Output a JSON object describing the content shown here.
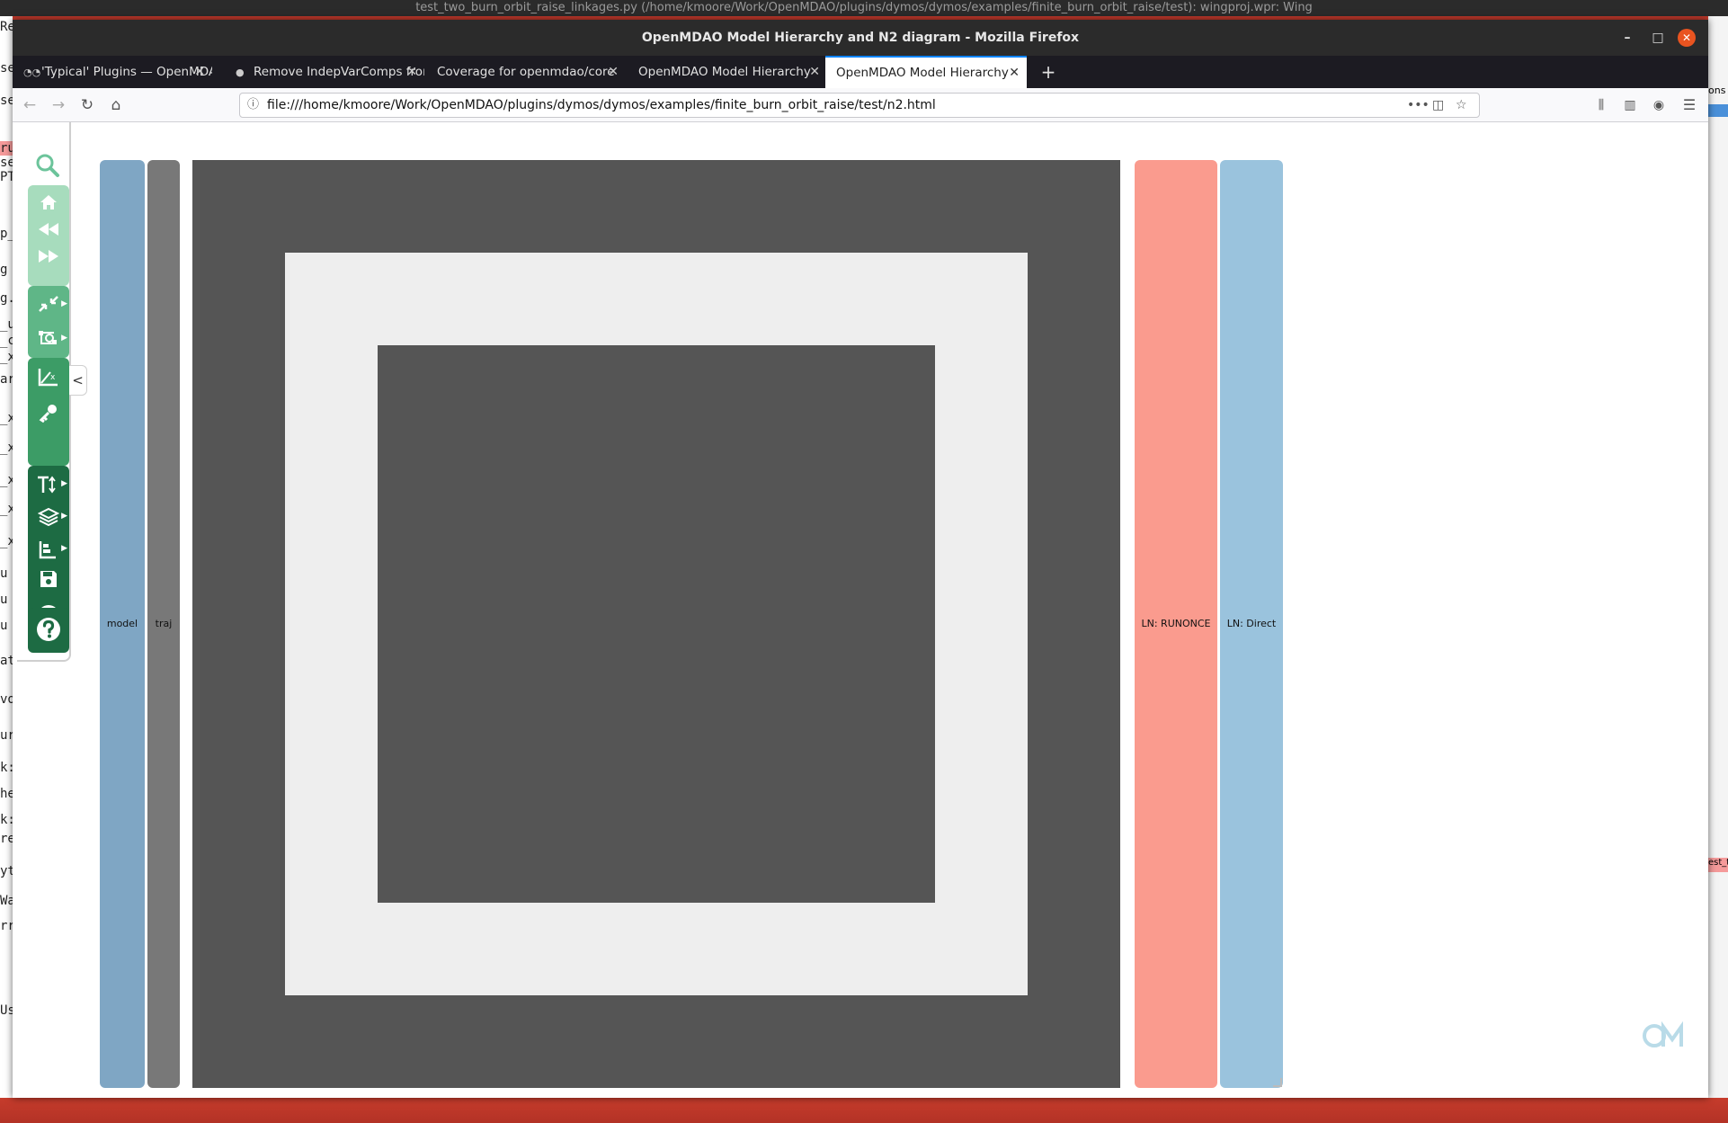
{
  "desktop": {
    "ide_title": "test_two_burn_orbit_raise_linkages.py (/home/kmoore/Work/OpenMDAO/plugins/dymos/dymos/examples/finite_burn_orbit_raise/test): wingproj.wpr: Wing",
    "left_fragments": [
      "Re",
      "se",
      "se",
      "ru",
      "se",
      "PT",
      "p_",
      "g",
      "g.",
      "_u",
      "_c",
      "_x",
      "ar",
      "_x",
      "_x",
      "_x",
      "_x",
      "_x",
      "u",
      "u",
      "u",
      "ats",
      "vo_",
      "urr",
      "k:",
      "he",
      "k:",
      "re",
      "yt",
      "Wa",
      "rr",
      "Use"
    ],
    "right_fragments": [
      "ons",
      "est_t"
    ]
  },
  "window": {
    "title": "OpenMDAO Model Hierarchy and N2 diagram - Mozilla Firefox",
    "minimize": "–",
    "maximize": "□",
    "close": "✕"
  },
  "tabs": [
    {
      "label": "'Typical' Plugins — OpenMDAO",
      "favicon": "om"
    },
    {
      "label": "Remove IndepVarComps from",
      "favicon": ""
    },
    {
      "label": "Coverage for openmdao/core",
      "favicon": ""
    },
    {
      "label": "OpenMDAO Model Hierarchy",
      "favicon": ""
    },
    {
      "label": "OpenMDAO Model Hierarchy",
      "favicon": "",
      "active": true
    }
  ],
  "new_tab": "+",
  "nav": {
    "url": "file:///home/kmoore/Work/OpenMDAO/plugins/dymos/dymos/examples/finite_burn_orbit_raise/test/n2.html",
    "page_actions": "•••"
  },
  "toolbar": {
    "icons": [
      "search-icon",
      "home-icon",
      "back-icon",
      "forward-icon",
      "collapse-icon",
      "connections-icon",
      "solver-plot-icon",
      "key-icon",
      "text-size-icon",
      "layers-icon",
      "depth-icon",
      "save-icon",
      "info-icon",
      "help-icon"
    ],
    "collapse_label": "<"
  },
  "hierarchy": {
    "model": "model",
    "traj": "traj"
  },
  "solvers": {
    "linear": "LN: RUNONCE",
    "linear2": "LN: Direct"
  },
  "colors": {
    "model": "#7fa6c4",
    "traj": "#787878",
    "ln_runonce": "#fa9b8e",
    "ln_direct": "#9ac3dd",
    "n2_dark": "#555555",
    "n2_light": "#eeeeee",
    "toolbar_light": "#a7dcbd",
    "toolbar_dark": "#1d6b43"
  }
}
